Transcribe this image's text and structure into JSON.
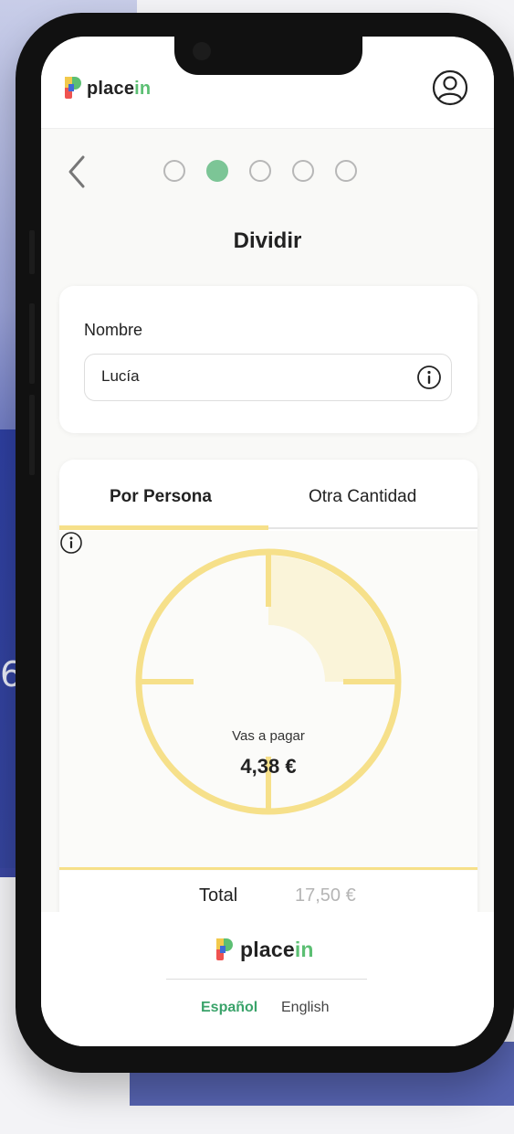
{
  "background": {
    "partial_number": "6"
  },
  "header": {
    "brand": {
      "prefix": "place",
      "suffix": "in"
    },
    "user_icon": "user-circle-icon"
  },
  "steps": {
    "total": 5,
    "active": 2
  },
  "page": {
    "title": "Dividir"
  },
  "name_card": {
    "label": "Nombre",
    "value": "Lucía",
    "info_icon": "info-icon"
  },
  "split_card": {
    "tabs": [
      {
        "label": "Por Persona",
        "active": true
      },
      {
        "label": "Otra Cantidad",
        "active": false
      }
    ],
    "pay_label": "Vas a pagar",
    "pay_amount": "4,38 €",
    "portions": 4,
    "selected_portions": 1,
    "total_label": "Total",
    "total_value": "17,50 €"
  },
  "footer": {
    "brand": {
      "prefix": "place",
      "suffix": "in"
    },
    "languages": [
      {
        "label": "Español",
        "active": true
      },
      {
        "label": "English",
        "active": false
      }
    ]
  },
  "colors": {
    "accent_green": "#5cbf73",
    "accent_yellow": "#f6e08a",
    "active_step": "#7cc596"
  }
}
